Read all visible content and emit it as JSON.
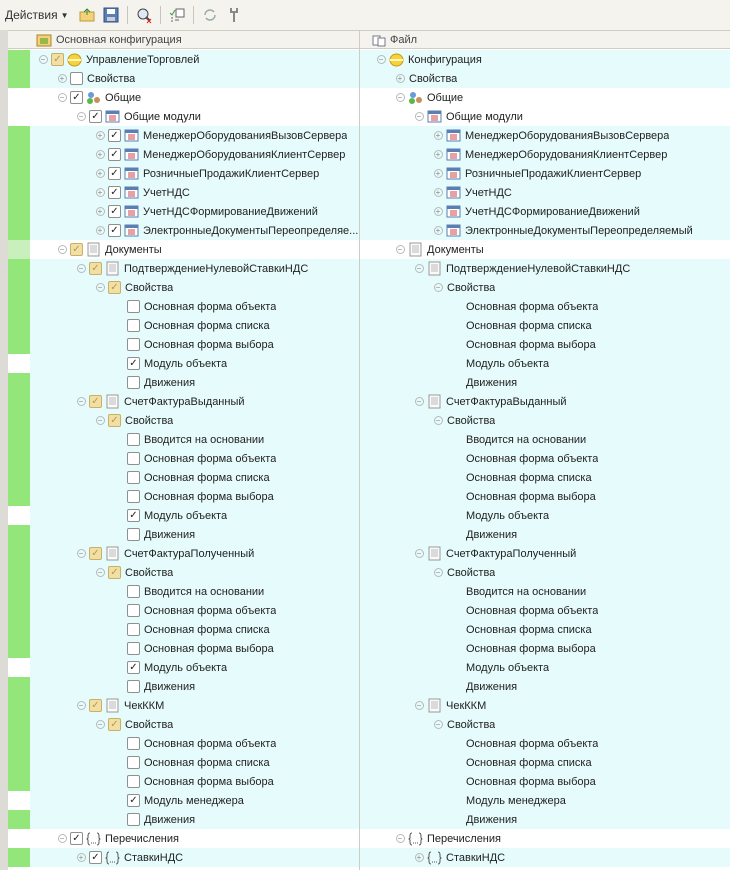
{
  "toolbar": {
    "actions_label": "Действия"
  },
  "columns": {
    "left": "Основная конфигурация",
    "right": "Файл"
  },
  "colors": {
    "row_cyan": "#e6fbfb",
    "gutter_green": "#92e67a",
    "gutter_light": "#c9efbd",
    "white": "#ffffff"
  },
  "rows": [
    {
      "lvl": 0,
      "exp": "minus",
      "cb": "partial",
      "icon": "config",
      "left": "УправлениеТорговлей",
      "right": "Конфигурация",
      "bg": "cyan",
      "gut": "green"
    },
    {
      "lvl": 1,
      "exp": "plus",
      "cb": "off",
      "icon": "",
      "left": "Свойства",
      "right": "Свойства",
      "bg": "cyan",
      "gut": "green"
    },
    {
      "lvl": 1,
      "exp": "minus",
      "cb": "on",
      "icon": "common",
      "left": "Общие",
      "right": "Общие",
      "bg": "white",
      "gut": "white"
    },
    {
      "lvl": 2,
      "exp": "minus",
      "cb": "on",
      "icon": "module",
      "left": "Общие модули",
      "right": "Общие модули",
      "bg": "white",
      "gut": "white"
    },
    {
      "lvl": 3,
      "exp": "plus",
      "cb": "on",
      "icon": "module",
      "left": "МенеджерОборудованияВызовСервера",
      "right": "МенеджерОборудованияВызовСервера",
      "bg": "cyan",
      "gut": "green"
    },
    {
      "lvl": 3,
      "exp": "plus",
      "cb": "on",
      "icon": "module",
      "left": "МенеджерОборудованияКлиентСервер",
      "right": "МенеджерОборудованияКлиентСервер",
      "bg": "cyan",
      "gut": "green"
    },
    {
      "lvl": 3,
      "exp": "plus",
      "cb": "on",
      "icon": "module",
      "left": "РозничныеПродажиКлиентСервер",
      "right": "РозничныеПродажиКлиентСервер",
      "bg": "cyan",
      "gut": "green"
    },
    {
      "lvl": 3,
      "exp": "plus",
      "cb": "on",
      "icon": "module",
      "left": "УчетНДС",
      "right": "УчетНДС",
      "bg": "cyan",
      "gut": "green"
    },
    {
      "lvl": 3,
      "exp": "plus",
      "cb": "on",
      "icon": "module",
      "left": "УчетНДСФормированиеДвижений",
      "right": "УчетНДСФормированиеДвижений",
      "bg": "cyan",
      "gut": "green"
    },
    {
      "lvl": 3,
      "exp": "plus",
      "cb": "on",
      "icon": "module",
      "left": "ЭлектронныеДокументыПереопределяе...",
      "right": "ЭлектронныеДокументыПереопределяемый",
      "bg": "cyan",
      "gut": "green"
    },
    {
      "lvl": 1,
      "exp": "minus",
      "cb": "partial",
      "icon": "doc",
      "left": "Документы",
      "right": "Документы",
      "bg": "white",
      "gut": "light"
    },
    {
      "lvl": 2,
      "exp": "minus",
      "cb": "partial",
      "icon": "doc",
      "left": "ПодтверждениеНулевойСтавкиНДС",
      "right": "ПодтверждениеНулевойСтавкиНДС",
      "bg": "cyan",
      "gut": "green"
    },
    {
      "lvl": 3,
      "exp": "minus",
      "cb": "partial",
      "icon": "",
      "left": "Свойства",
      "right": "Свойства",
      "bg": "cyan",
      "gut": "green"
    },
    {
      "lvl": 4,
      "exp": "",
      "cb": "off",
      "icon": "",
      "left": "Основная форма объекта",
      "right": "Основная форма объекта",
      "bg": "cyan",
      "gut": "green"
    },
    {
      "lvl": 4,
      "exp": "",
      "cb": "off",
      "icon": "",
      "left": "Основная форма списка",
      "right": "Основная форма списка",
      "bg": "cyan",
      "gut": "green"
    },
    {
      "lvl": 4,
      "exp": "",
      "cb": "off",
      "icon": "",
      "left": "Основная форма выбора",
      "right": "Основная форма выбора",
      "bg": "cyan",
      "gut": "green"
    },
    {
      "lvl": 4,
      "exp": "",
      "cb": "on",
      "icon": "",
      "left": "Модуль объекта",
      "right": "Модуль объекта",
      "bg": "cyan",
      "gut": "white"
    },
    {
      "lvl": 4,
      "exp": "",
      "cb": "off",
      "icon": "",
      "left": "Движения",
      "right": "Движения",
      "bg": "cyan",
      "gut": "green"
    },
    {
      "lvl": 2,
      "exp": "minus",
      "cb": "partial",
      "icon": "doc",
      "left": "СчетФактураВыданный",
      "right": "СчетФактураВыданный",
      "bg": "cyan",
      "gut": "green"
    },
    {
      "lvl": 3,
      "exp": "minus",
      "cb": "partial",
      "icon": "",
      "left": "Свойства",
      "right": "Свойства",
      "bg": "cyan",
      "gut": "green"
    },
    {
      "lvl": 4,
      "exp": "",
      "cb": "off",
      "icon": "",
      "left": "Вводится на основании",
      "right": "Вводится на основании",
      "bg": "cyan",
      "gut": "green"
    },
    {
      "lvl": 4,
      "exp": "",
      "cb": "off",
      "icon": "",
      "left": "Основная форма объекта",
      "right": "Основная форма объекта",
      "bg": "cyan",
      "gut": "green"
    },
    {
      "lvl": 4,
      "exp": "",
      "cb": "off",
      "icon": "",
      "left": "Основная форма списка",
      "right": "Основная форма списка",
      "bg": "cyan",
      "gut": "green"
    },
    {
      "lvl": 4,
      "exp": "",
      "cb": "off",
      "icon": "",
      "left": "Основная форма выбора",
      "right": "Основная форма выбора",
      "bg": "cyan",
      "gut": "green"
    },
    {
      "lvl": 4,
      "exp": "",
      "cb": "on",
      "icon": "",
      "left": "Модуль объекта",
      "right": "Модуль объекта",
      "bg": "cyan",
      "gut": "white"
    },
    {
      "lvl": 4,
      "exp": "",
      "cb": "off",
      "icon": "",
      "left": "Движения",
      "right": "Движения",
      "bg": "cyan",
      "gut": "green"
    },
    {
      "lvl": 2,
      "exp": "minus",
      "cb": "partial",
      "icon": "doc",
      "left": "СчетФактураПолученный",
      "right": "СчетФактураПолученный",
      "bg": "cyan",
      "gut": "green"
    },
    {
      "lvl": 3,
      "exp": "minus",
      "cb": "partial",
      "icon": "",
      "left": "Свойства",
      "right": "Свойства",
      "bg": "cyan",
      "gut": "green"
    },
    {
      "lvl": 4,
      "exp": "",
      "cb": "off",
      "icon": "",
      "left": "Вводится на основании",
      "right": "Вводится на основании",
      "bg": "cyan",
      "gut": "green"
    },
    {
      "lvl": 4,
      "exp": "",
      "cb": "off",
      "icon": "",
      "left": "Основная форма объекта",
      "right": "Основная форма объекта",
      "bg": "cyan",
      "gut": "green"
    },
    {
      "lvl": 4,
      "exp": "",
      "cb": "off",
      "icon": "",
      "left": "Основная форма списка",
      "right": "Основная форма списка",
      "bg": "cyan",
      "gut": "green"
    },
    {
      "lvl": 4,
      "exp": "",
      "cb": "off",
      "icon": "",
      "left": "Основная форма выбора",
      "right": "Основная форма выбора",
      "bg": "cyan",
      "gut": "green"
    },
    {
      "lvl": 4,
      "exp": "",
      "cb": "on",
      "icon": "",
      "left": "Модуль объекта",
      "right": "Модуль объекта",
      "bg": "cyan",
      "gut": "white"
    },
    {
      "lvl": 4,
      "exp": "",
      "cb": "off",
      "icon": "",
      "left": "Движения",
      "right": "Движения",
      "bg": "cyan",
      "gut": "green"
    },
    {
      "lvl": 2,
      "exp": "minus",
      "cb": "partial",
      "icon": "doc",
      "left": "ЧекККМ",
      "right": "ЧекККМ",
      "bg": "cyan",
      "gut": "green"
    },
    {
      "lvl": 3,
      "exp": "minus",
      "cb": "partial",
      "icon": "",
      "left": "Свойства",
      "right": "Свойства",
      "bg": "cyan",
      "gut": "green"
    },
    {
      "lvl": 4,
      "exp": "",
      "cb": "off",
      "icon": "",
      "left": "Основная форма объекта",
      "right": "Основная форма объекта",
      "bg": "cyan",
      "gut": "green"
    },
    {
      "lvl": 4,
      "exp": "",
      "cb": "off",
      "icon": "",
      "left": "Основная форма списка",
      "right": "Основная форма списка",
      "bg": "cyan",
      "gut": "green"
    },
    {
      "lvl": 4,
      "exp": "",
      "cb": "off",
      "icon": "",
      "left": "Основная форма выбора",
      "right": "Основная форма выбора",
      "bg": "cyan",
      "gut": "green"
    },
    {
      "lvl": 4,
      "exp": "",
      "cb": "on",
      "icon": "",
      "left": "Модуль менеджера",
      "right": "Модуль менеджера",
      "bg": "cyan",
      "gut": "white"
    },
    {
      "lvl": 4,
      "exp": "",
      "cb": "off",
      "icon": "",
      "left": "Движения",
      "right": "Движения",
      "bg": "cyan",
      "gut": "green"
    },
    {
      "lvl": 1,
      "exp": "minus",
      "cb": "on",
      "icon": "enum",
      "left": "Перечисления",
      "right": "Перечисления",
      "bg": "white",
      "gut": "white"
    },
    {
      "lvl": 2,
      "exp": "plus",
      "cb": "on",
      "icon": "enum",
      "left": "СтавкиНДС",
      "right": "СтавкиНДС",
      "bg": "cyan",
      "gut": "green"
    }
  ]
}
